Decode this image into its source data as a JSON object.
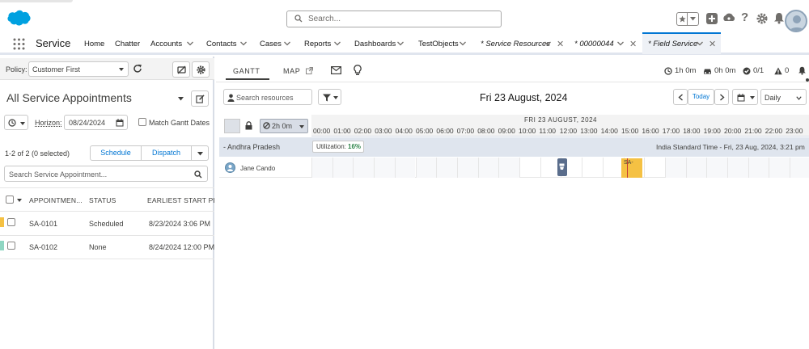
{
  "header": {
    "search_placeholder": "Search..."
  },
  "nav": {
    "app_name": "Service",
    "tabs": [
      {
        "label": "Home"
      },
      {
        "label": "Chatter"
      },
      {
        "label": "Accounts"
      },
      {
        "label": "Contacts"
      },
      {
        "label": "Cases"
      },
      {
        "label": "Reports"
      },
      {
        "label": "Dashboards"
      },
      {
        "label": "TestObjects"
      },
      {
        "label": "* Service Resources"
      },
      {
        "label": "* 00000044"
      },
      {
        "label": "* Field Service"
      }
    ]
  },
  "left": {
    "policy_label": "Policy:",
    "policy_value": "Customer First",
    "list_title": "All Service Appointments",
    "horizon_label": "Horizon:",
    "horizon_date": "08/24/2024",
    "match_gantt_label": "Match Gantt Dates",
    "selection_count": "1-2 of 2 (0 selected)",
    "schedule_label": "Schedule",
    "dispatch_label": "Dispatch",
    "search_placeholder": "Search Service Appointment...",
    "columns": [
      "APPOINTMEN...",
      "STATUS",
      "EARLIEST START PERM"
    ],
    "rows": [
      {
        "id": "SA-0101",
        "status": "Scheduled",
        "start": "8/23/2024 3:06 PM",
        "color": "#f5c143"
      },
      {
        "id": "SA-0102",
        "status": "None",
        "start": "8/24/2024 12:00 PM",
        "color": "#8fd6c2"
      }
    ]
  },
  "right": {
    "tabs": [
      "GANTT",
      "MAP"
    ],
    "stats": {
      "travel": "1h 0m",
      "drive": "0h 0m",
      "done": "0/1",
      "warnings": "0"
    },
    "search_resources_placeholder": "Search resources",
    "date_title": "Fri 23 August, 2024",
    "today_label": "Today",
    "view_value": "Daily",
    "duration_value": "2h 0m",
    "timeline_date": "FRI 23 AUGUST, 2024",
    "hours": [
      "00:00",
      "01:00",
      "02:00",
      "03:00",
      "04:00",
      "05:00",
      "06:00",
      "07:00",
      "08:00",
      "09:00",
      "10:00",
      "11:00",
      "12:00",
      "13:00",
      "14:00",
      "15:00",
      "16:00",
      "17:00",
      "18:00",
      "19:00",
      "20:00",
      "21:00",
      "22:00",
      "23:00"
    ],
    "region": "- Andhra Pradesh",
    "utilization_label": "Utilization:",
    "utilization_value": "16%",
    "timezone_text": "India Standard Time - Fri, 23 Aug, 2024, 3:21 pm",
    "resource_name": "Jane Cando",
    "appointment_label": "SA-"
  },
  "colors": {
    "brand_blue": "#0176d3",
    "appointment_yellow": "#f5c143",
    "utilization_green": "#2e844a"
  }
}
